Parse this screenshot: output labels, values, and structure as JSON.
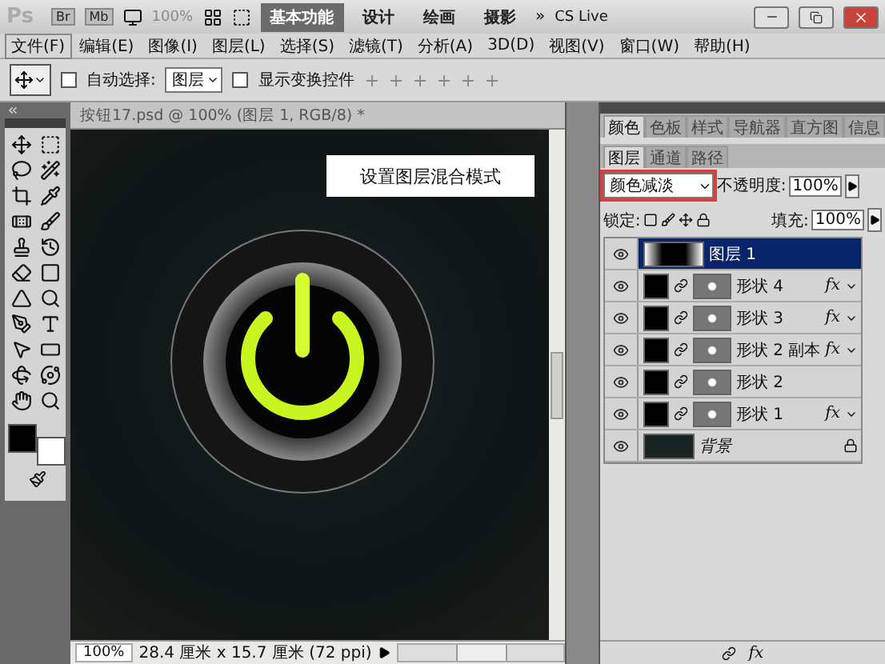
{
  "app_bar": {
    "logo": "Ps",
    "bridge": "Br",
    "mini_bridge": "Mb",
    "zoom": "100%",
    "more": "»",
    "cs_live": "CS Live",
    "workspaces": [
      {
        "label": "基本功能",
        "selected": true
      },
      {
        "label": "设计",
        "selected": false
      },
      {
        "label": "绘画",
        "selected": false
      },
      {
        "label": "摄影",
        "selected": false
      }
    ]
  },
  "menu": [
    {
      "label": "文件(F)",
      "selected": true
    },
    {
      "label": "编辑(E)",
      "selected": false
    },
    {
      "label": "图像(I)",
      "selected": false
    },
    {
      "label": "图层(L)",
      "selected": false
    },
    {
      "label": "选择(S)",
      "selected": false
    },
    {
      "label": "滤镜(T)",
      "selected": false
    },
    {
      "label": "分析(A)",
      "selected": false
    },
    {
      "label": "3D(D)",
      "selected": false
    },
    {
      "label": "视图(V)",
      "selected": false
    },
    {
      "label": "窗口(W)",
      "selected": false
    },
    {
      "label": "帮助(H)",
      "selected": false
    }
  ],
  "options_bar": {
    "auto_select": {
      "label": "自动选择:",
      "checked": false
    },
    "auto_select_target": "图层",
    "show_transform": {
      "label": "显示变换控件",
      "checked": false
    }
  },
  "document": {
    "title": "按钮17.psd @ 100% (图层 1, RGB/8) *",
    "annotation": "设置图层混合模式",
    "zoom": "100%",
    "info": "28.4 厘米 x 15.7 厘米 (72 ppi)"
  },
  "top_panel_tabs": [
    {
      "label": "颜色",
      "selected": true
    },
    {
      "label": "色板",
      "selected": false
    },
    {
      "label": "样式",
      "selected": false
    },
    {
      "label": "导航器",
      "selected": false
    },
    {
      "label": "直方图",
      "selected": false
    },
    {
      "label": "信息",
      "selected": false
    }
  ],
  "layers_panel": {
    "tabs": [
      {
        "label": "图层",
        "selected": true
      },
      {
        "label": "通道",
        "selected": false
      },
      {
        "label": "路径",
        "selected": false
      }
    ],
    "blend_mode": "颜色减淡",
    "opacity_label": "不透明度:",
    "opacity": "100%",
    "lock_label": "锁定:",
    "fill_label": "填充:",
    "fill": "100%",
    "footer_fx": "fx",
    "layers": [
      {
        "name": "图层 1",
        "kind": "pixel",
        "selected": true
      },
      {
        "name": "形状 4",
        "kind": "shape",
        "fx": "fx",
        "selected": false
      },
      {
        "name": "形状 3",
        "kind": "shape",
        "fx": "fx",
        "selected": false
      },
      {
        "name": "形状 2 副本",
        "kind": "shape",
        "fx": "fx",
        "selected": false
      },
      {
        "name": "形状 2",
        "kind": "shape",
        "selected": false
      },
      {
        "name": "形状 1",
        "kind": "shape",
        "fx": "fx",
        "selected": false
      },
      {
        "name": "背景",
        "kind": "background",
        "selected": false
      }
    ]
  }
}
